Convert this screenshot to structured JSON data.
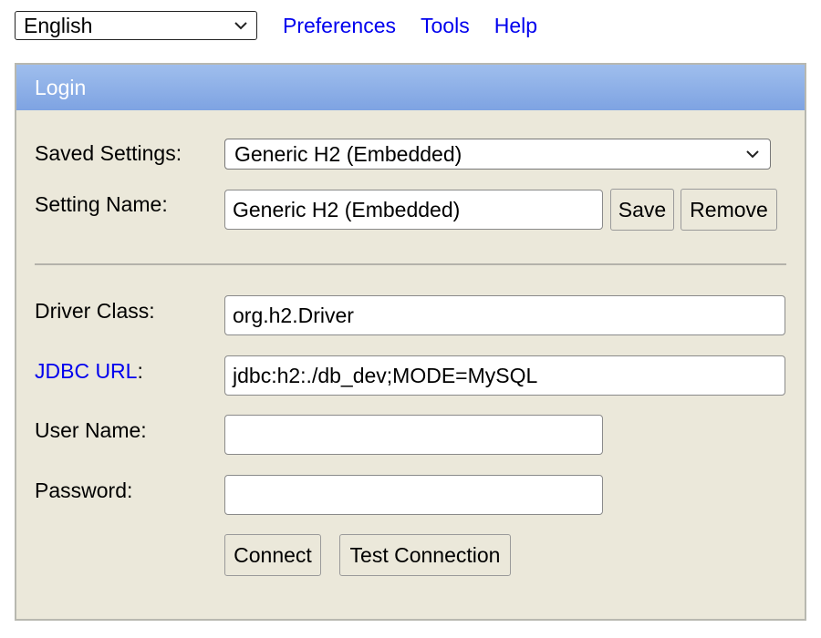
{
  "topbar": {
    "language": "English",
    "links": [
      "Preferences",
      "Tools",
      "Help"
    ]
  },
  "login": {
    "title": "Login",
    "saved_settings_label": "Saved Settings:",
    "saved_settings_value": "Generic H2 (Embedded)",
    "setting_name_label": "Setting Name:",
    "setting_name_value": "Generic H2 (Embedded)",
    "save_label": "Save",
    "remove_label": "Remove",
    "driver_class_label": "Driver Class:",
    "driver_class_value": "org.h2.Driver",
    "jdbc_url_link": "JDBC URL",
    "jdbc_url_colon": ":",
    "jdbc_url_value": "jdbc:h2:./db_dev;MODE=MySQL",
    "user_name_label": "User Name:",
    "user_name_value": "",
    "password_label": "Password:",
    "password_value": "",
    "connect_label": "Connect",
    "test_connection_label": "Test Connection"
  },
  "colors": {
    "header_gradient_top": "#9fbeed",
    "header_gradient_bottom": "#7ea3e2",
    "panel_bg": "#ebe8da",
    "link": "#0000ee"
  },
  "icons": {
    "dropdown": "chevron-down-icon"
  }
}
